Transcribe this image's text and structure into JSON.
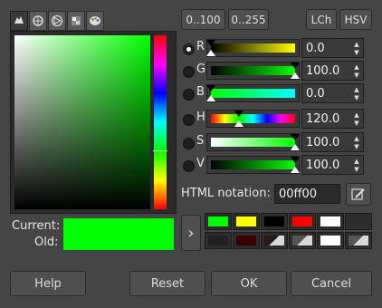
{
  "tabs": [
    {
      "icon": "gimp-icon",
      "active": true
    },
    {
      "icon": "cmyk-icon"
    },
    {
      "icon": "triangle-icon"
    },
    {
      "icon": "watercolor-icon"
    },
    {
      "icon": "palette-icon"
    }
  ],
  "current_label": "Current:",
  "old_label": "Old:",
  "current_color": "#00ff00",
  "old_color": "#00ff00",
  "range_buttons": {
    "r100": "0..100",
    "r255": "0..255"
  },
  "space_buttons": {
    "lch": "LCh",
    "hsv": "HSV"
  },
  "channels": [
    {
      "label": "R",
      "value": "0.0",
      "selected": true
    },
    {
      "label": "G",
      "value": "100.0"
    },
    {
      "label": "B",
      "value": "0.0"
    },
    {
      "label": "H",
      "value": "120.0"
    },
    {
      "label": "S",
      "value": "100.0"
    },
    {
      "label": "V",
      "value": "100.0"
    }
  ],
  "html_notation": {
    "label": "HTML notation:",
    "value": "00ff00"
  },
  "history_colors": [
    "#00ff00",
    "#ffff00",
    "#000000",
    "#ff0000",
    "#ffffff",
    "#2d2d2d",
    "#222222",
    "#3a0000",
    "#2a1a1a",
    "#555555",
    "#ffffff",
    "#555555"
  ],
  "buttons": {
    "help": "Help",
    "reset": "Reset",
    "ok": "OK",
    "cancel": "Cancel"
  },
  "arrow_label": "›"
}
